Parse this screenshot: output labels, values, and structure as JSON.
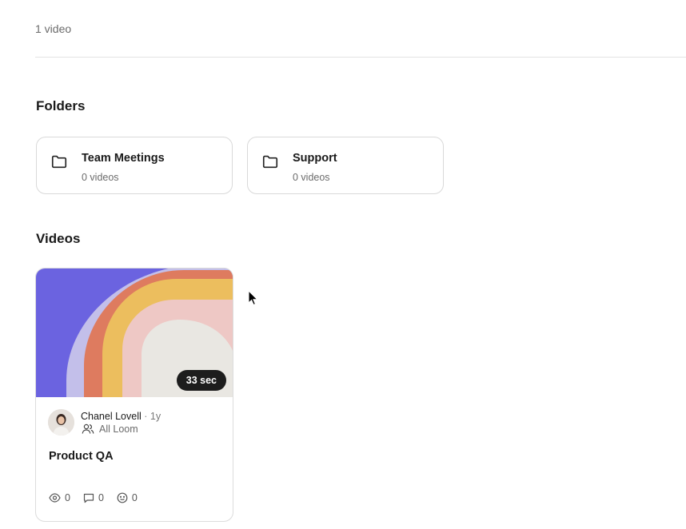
{
  "header": {
    "video_count": "1 video"
  },
  "folders_section": {
    "title": "Folders",
    "items": [
      {
        "name": "Team Meetings",
        "count": "0 videos",
        "icon": "folder-icon"
      },
      {
        "name": "Support",
        "count": "0 videos",
        "icon": "folder-icon"
      }
    ]
  },
  "videos_section": {
    "title": "Videos",
    "items": [
      {
        "title": "Product QA",
        "duration": "33 sec",
        "author": "Chanel Lovell",
        "separator": "·",
        "age": "1y",
        "space": "All Loom",
        "views": "0",
        "comments": "0",
        "reactions": "0"
      }
    ]
  },
  "colors": {
    "thumb_purple": "#6b63e0",
    "thumb_lavender": "#c3bfea",
    "thumb_coral": "#de7b5f",
    "thumb_yellow": "#ecbe5e",
    "thumb_pink": "#eec8c5",
    "thumb_cream": "#e9e7e2"
  }
}
